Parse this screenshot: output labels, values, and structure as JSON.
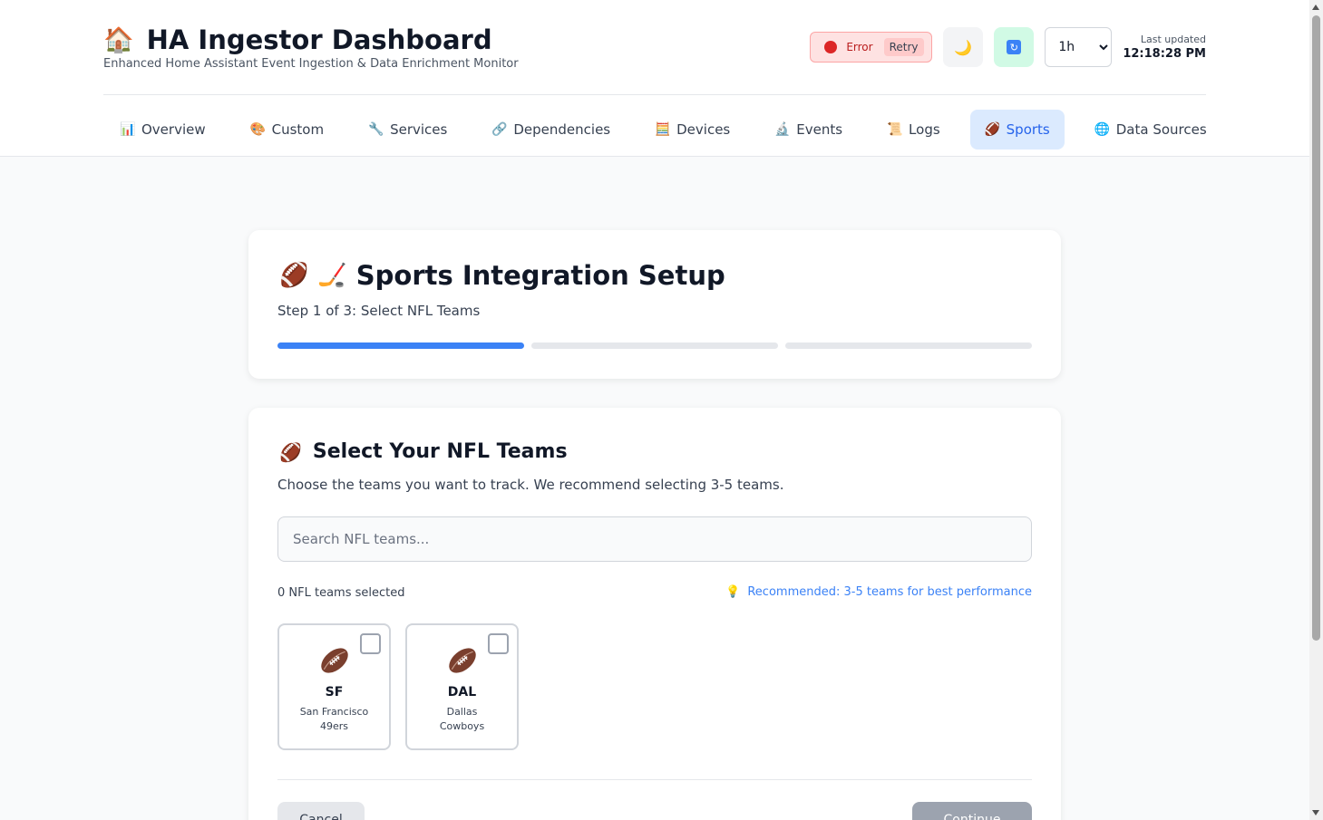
{
  "header": {
    "title": "HA Ingestor Dashboard",
    "subtitle": "Enhanced Home Assistant Event Ingestion & Data Enrichment Monitor",
    "status_label": "Error",
    "retry_label": "Retry",
    "time_range": "1h",
    "time_range_options": [
      "1h"
    ],
    "last_updated_label": "Last updated",
    "last_updated_time": "12:18:28 PM"
  },
  "tabs": [
    {
      "label": "Overview",
      "icon": "chart-icon",
      "glyph": "📊"
    },
    {
      "label": "Custom",
      "icon": "palette-icon",
      "glyph": "🎨"
    },
    {
      "label": "Services",
      "icon": "wrench-icon",
      "glyph": "🔧"
    },
    {
      "label": "Dependencies",
      "icon": "link-icon",
      "glyph": "🔗"
    },
    {
      "label": "Devices",
      "icon": "calculator-icon",
      "glyph": "🧮"
    },
    {
      "label": "Events",
      "icon": "microscope-icon",
      "glyph": "🔬"
    },
    {
      "label": "Logs",
      "icon": "scroll-icon",
      "glyph": "📜"
    },
    {
      "label": "Sports",
      "icon": "football-icon",
      "glyph": "🏈",
      "active": true
    },
    {
      "label": "Data Sources",
      "icon": "globe-icon",
      "glyph": "🌐"
    }
  ],
  "setup": {
    "title": "Sports Integration Setup",
    "step_text": "Step 1 of 3: Select NFL Teams",
    "current_step": 1,
    "total_steps": 3
  },
  "teams_section": {
    "title": "Select Your NFL Teams",
    "description": "Choose the teams you want to track. We recommend selecting 3-5 teams.",
    "search_placeholder": "Search NFL teams...",
    "selected_count": "0 NFL teams selected",
    "recommendation": "Recommended: 3-5 teams for best performance",
    "teams": [
      {
        "abbr": "SF",
        "name": "San Francisco 49ers",
        "selected": false
      },
      {
        "abbr": "DAL",
        "name": "Dallas Cowboys",
        "selected": false
      }
    ],
    "back_label": "Cancel",
    "next_label": "Continue"
  },
  "colors": {
    "accent": "#3b82f6",
    "error": "#dc2626",
    "active_tab_bg": "#dbeafe"
  }
}
